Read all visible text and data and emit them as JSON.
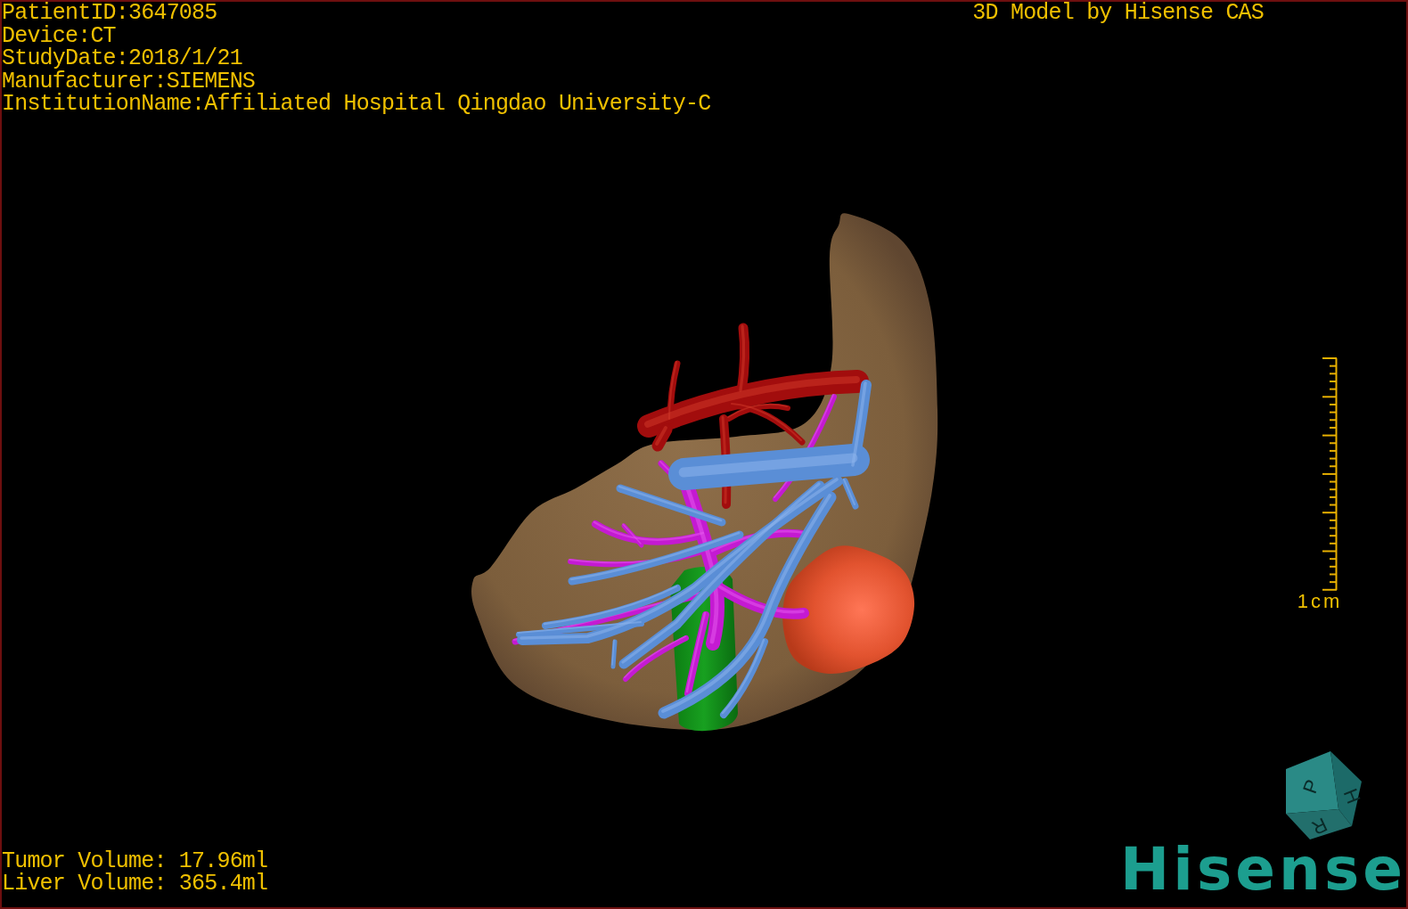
{
  "patient_info": [
    "PatientID:3647085",
    "Device:CT",
    "StudyDate:2018/1/21",
    "Manufacturer:SIEMENS",
    "InstitutionName:Affiliated Hospital Qingdao University-C"
  ],
  "model_credit": "3D Model by Hisense CAS",
  "scale_bar": {
    "label": "1cm"
  },
  "volumes": [
    "Tumor Volume: 17.96ml",
    "Liver Volume: 365.4ml"
  ],
  "orientation_cube": {
    "labels": [
      "P",
      "H",
      "R"
    ]
  },
  "logo": {
    "text": "Hisense"
  }
}
